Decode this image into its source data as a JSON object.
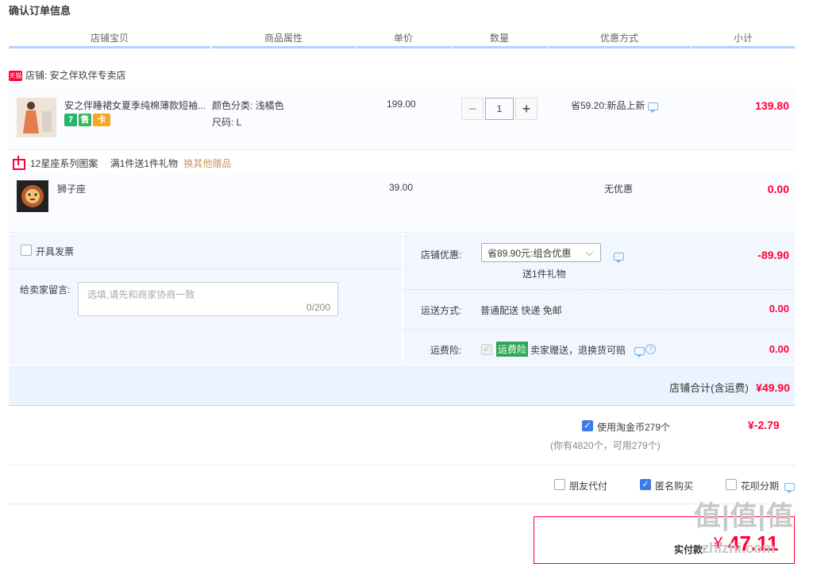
{
  "page_title": "确认订单信息",
  "columns": [
    "店铺宝贝",
    "商品属性",
    "单价",
    "数量",
    "优惠方式",
    "小计"
  ],
  "shop": {
    "label": "店铺: 安之伴玖伴专卖店",
    "badge": "天猫"
  },
  "item": {
    "name": "安之伴睡裙女夏季纯棉薄款短袖...",
    "attr_color": "颜色分类: 浅橘色",
    "attr_size": "尺码: L",
    "price": "199.00",
    "quantity": "1",
    "promo": "省59.20:新品上新",
    "subtotal": "139.80",
    "badges": [
      "7",
      "售",
      "卡"
    ]
  },
  "gift_bar": {
    "series": "12星座系列图案",
    "rule": "满1件送1件礼物",
    "change_link": "换其他赠品"
  },
  "gift_item": {
    "name": "狮子座",
    "price": "39.00",
    "promo": "无优惠",
    "subtotal": "0.00"
  },
  "invoice_label": "开具发票",
  "message": {
    "label": "给卖家留言:",
    "placeholder": "选填,请先和商家协商一致",
    "counter": "0/200"
  },
  "shop_discount": {
    "label": "店铺优惠:",
    "selected": "省89.90元:组合优惠",
    "note": "送1件礼物",
    "amount": "-89.90"
  },
  "shipping": {
    "label": "运送方式:",
    "value": "普通配送 快递 免邮",
    "amount": "0.00"
  },
  "insurance": {
    "label": "运费险:",
    "tag": "运费险",
    "text": "卖家赠送，退换货可赔",
    "amount": "0.00"
  },
  "shop_total": {
    "label": "店铺合计(含运费)",
    "amount": "¥49.90"
  },
  "coins": {
    "label": "使用淘金币279个",
    "amount": "¥-2.79",
    "note": "(你有4820个，可用279个)"
  },
  "options": {
    "friend_pay": "朋友代付",
    "anonymous": "匿名购买",
    "huabei": "花呗分期"
  },
  "pay": {
    "label": "实付款:",
    "currency": "¥",
    "amount": "47.11"
  },
  "watermark": {
    "main": "值|值|值",
    "sub": "zhizhi.com"
  },
  "colors": {
    "accent": "#ff0036",
    "header_line": "#b2d1ff",
    "panel": "#f2f7ff",
    "checkbox": "#3d7bea"
  }
}
